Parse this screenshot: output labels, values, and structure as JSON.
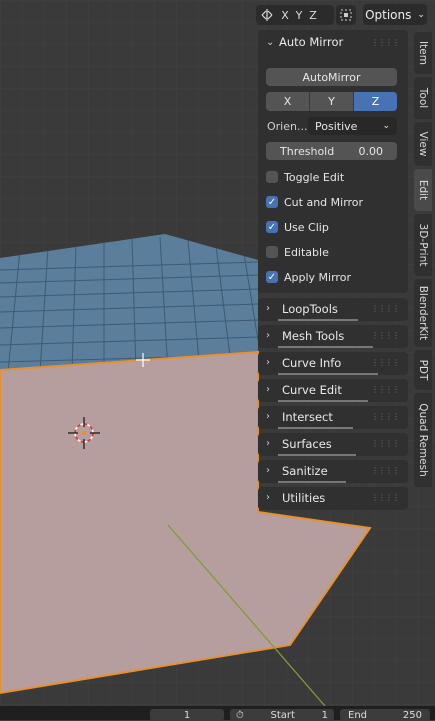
{
  "header": {
    "axes": [
      "X",
      "Y",
      "Z"
    ],
    "options_label": "Options"
  },
  "panel": {
    "title": "Auto Mirror",
    "automirror_button": "AutoMirror",
    "axes": [
      "X",
      "Y",
      "Z"
    ],
    "active_axis": "Z",
    "orientation_label": "Orien...",
    "orientation_value": "Positive",
    "threshold_label": "Threshold",
    "threshold_value": "0.00",
    "checkboxes": [
      {
        "label": "Toggle Edit",
        "checked": false
      },
      {
        "label": "Cut and Mirror",
        "checked": true
      },
      {
        "label": "Use Clip",
        "checked": true
      },
      {
        "label": "Editable",
        "checked": false
      },
      {
        "label": "Apply Mirror",
        "checked": true
      }
    ]
  },
  "collapsed_panels": [
    "LoopTools",
    "Mesh Tools",
    "Curve Info",
    "Curve Edit",
    "Intersect",
    "Surfaces",
    "Sanitize",
    "Utilities"
  ],
  "tabs": [
    "Item",
    "Tool",
    "View",
    "Edit",
    "3D-Print",
    "BlenderKit",
    "PDT",
    "Quad Remesh"
  ],
  "active_tab": "Edit",
  "footer": {
    "current_frame": "1",
    "start_label": "Start",
    "start_value": "1",
    "end_label": "End",
    "end_value": "250"
  },
  "colors": {
    "accent": "#4772b3",
    "viewport_bg": "#3b3b3b",
    "face_selected": "#b49c9c",
    "edge_selected": "#e8902e",
    "plane_blue": "#5a7e9c"
  },
  "icons": {
    "mirror_toggle": "mirror-axis-icon",
    "gizmo": "gizmo-icon",
    "origin": "object-origin-icon",
    "cursor": "crosshair-cursor-icon"
  }
}
